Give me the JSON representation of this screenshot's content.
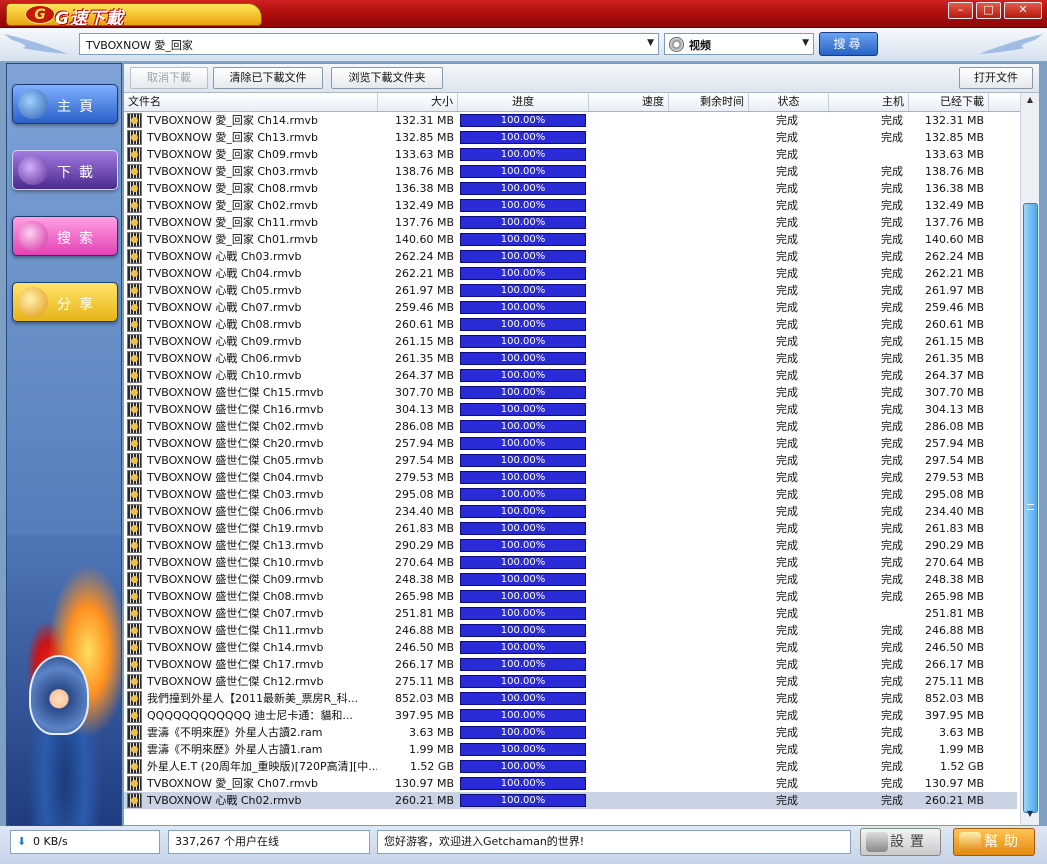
{
  "app": {
    "logo_text": "G速下載",
    "logo_badge": "G"
  },
  "window_controls": {
    "minimize": "–",
    "maximize": "□",
    "close": "✕"
  },
  "header": {
    "search_value": "TVBOXNOW 愛_回家",
    "type_value": "视频",
    "search_button": "搜尋"
  },
  "sidebar": {
    "items": [
      {
        "label": "主頁"
      },
      {
        "label": "下載"
      },
      {
        "label": "搜索"
      },
      {
        "label": "分享"
      }
    ]
  },
  "toolbar": {
    "cancel": "取消下載",
    "clear": "清除已下載文件",
    "browse": "浏览下載文件夹",
    "open": "打开文件"
  },
  "columns": {
    "name": "文件名",
    "size": "大小",
    "progress": "进度",
    "speed": "速度",
    "remaining": "剩余时间",
    "status": "状态",
    "host": "主机",
    "downloaded": "已经下載"
  },
  "rows": [
    {
      "name": "TVBOXNOW 愛_回家 Ch14.rmvb",
      "size": "132.31 MB",
      "progress": "100.00%",
      "status": "完成",
      "host": "完成",
      "downloaded": "132.31 MB"
    },
    {
      "name": "TVBOXNOW 愛_回家 Ch13.rmvb",
      "size": "132.85 MB",
      "progress": "100.00%",
      "status": "完成",
      "host": "完成",
      "downloaded": "132.85 MB"
    },
    {
      "name": "TVBOXNOW 愛_回家 Ch09.rmvb",
      "size": "133.63 MB",
      "progress": "100.00%",
      "status": "完成",
      "host": "",
      "downloaded": "133.63 MB"
    },
    {
      "name": "TVBOXNOW 愛_回家 Ch03.rmvb",
      "size": "138.76 MB",
      "progress": "100.00%",
      "status": "完成",
      "host": "完成",
      "downloaded": "138.76 MB"
    },
    {
      "name": "TVBOXNOW 愛_回家 Ch08.rmvb",
      "size": "136.38 MB",
      "progress": "100.00%",
      "status": "完成",
      "host": "完成",
      "downloaded": "136.38 MB"
    },
    {
      "name": "TVBOXNOW 愛_回家 Ch02.rmvb",
      "size": "132.49 MB",
      "progress": "100.00%",
      "status": "完成",
      "host": "完成",
      "downloaded": "132.49 MB"
    },
    {
      "name": "TVBOXNOW 愛_回家 Ch11.rmvb",
      "size": "137.76 MB",
      "progress": "100.00%",
      "status": "完成",
      "host": "完成",
      "downloaded": "137.76 MB"
    },
    {
      "name": "TVBOXNOW 愛_回家 Ch01.rmvb",
      "size": "140.60 MB",
      "progress": "100.00%",
      "status": "完成",
      "host": "完成",
      "downloaded": "140.60 MB"
    },
    {
      "name": "TVBOXNOW 心戰 Ch03.rmvb",
      "size": "262.24 MB",
      "progress": "100.00%",
      "status": "完成",
      "host": "完成",
      "downloaded": "262.24 MB"
    },
    {
      "name": "TVBOXNOW 心戰 Ch04.rmvb",
      "size": "262.21 MB",
      "progress": "100.00%",
      "status": "完成",
      "host": "完成",
      "downloaded": "262.21 MB"
    },
    {
      "name": "TVBOXNOW 心戰 Ch05.rmvb",
      "size": "261.97 MB",
      "progress": "100.00%",
      "status": "完成",
      "host": "完成",
      "downloaded": "261.97 MB"
    },
    {
      "name": "TVBOXNOW 心戰 Ch07.rmvb",
      "size": "259.46 MB",
      "progress": "100.00%",
      "status": "完成",
      "host": "完成",
      "downloaded": "259.46 MB"
    },
    {
      "name": "TVBOXNOW 心戰 Ch08.rmvb",
      "size": "260.61 MB",
      "progress": "100.00%",
      "status": "完成",
      "host": "完成",
      "downloaded": "260.61 MB"
    },
    {
      "name": "TVBOXNOW 心戰 Ch09.rmvb",
      "size": "261.15 MB",
      "progress": "100.00%",
      "status": "完成",
      "host": "完成",
      "downloaded": "261.15 MB"
    },
    {
      "name": "TVBOXNOW 心戰 Ch06.rmvb",
      "size": "261.35 MB",
      "progress": "100.00%",
      "status": "完成",
      "host": "完成",
      "downloaded": "261.35 MB"
    },
    {
      "name": "TVBOXNOW 心戰 Ch10.rmvb",
      "size": "264.37 MB",
      "progress": "100.00%",
      "status": "完成",
      "host": "完成",
      "downloaded": "264.37 MB"
    },
    {
      "name": "TVBOXNOW 盛世仁傑 Ch15.rmvb",
      "size": "307.70 MB",
      "progress": "100.00%",
      "status": "完成",
      "host": "完成",
      "downloaded": "307.70 MB"
    },
    {
      "name": "TVBOXNOW 盛世仁傑 Ch16.rmvb",
      "size": "304.13 MB",
      "progress": "100.00%",
      "status": "完成",
      "host": "完成",
      "downloaded": "304.13 MB"
    },
    {
      "name": "TVBOXNOW 盛世仁傑 Ch02.rmvb",
      "size": "286.08 MB",
      "progress": "100.00%",
      "status": "完成",
      "host": "完成",
      "downloaded": "286.08 MB"
    },
    {
      "name": "TVBOXNOW 盛世仁傑 Ch20.rmvb",
      "size": "257.94 MB",
      "progress": "100.00%",
      "status": "完成",
      "host": "完成",
      "downloaded": "257.94 MB"
    },
    {
      "name": "TVBOXNOW 盛世仁傑 Ch05.rmvb",
      "size": "297.54 MB",
      "progress": "100.00%",
      "status": "完成",
      "host": "完成",
      "downloaded": "297.54 MB"
    },
    {
      "name": "TVBOXNOW 盛世仁傑 Ch04.rmvb",
      "size": "279.53 MB",
      "progress": "100.00%",
      "status": "完成",
      "host": "完成",
      "downloaded": "279.53 MB"
    },
    {
      "name": "TVBOXNOW 盛世仁傑 Ch03.rmvb",
      "size": "295.08 MB",
      "progress": "100.00%",
      "status": "完成",
      "host": "完成",
      "downloaded": "295.08 MB"
    },
    {
      "name": "TVBOXNOW 盛世仁傑 Ch06.rmvb",
      "size": "234.40 MB",
      "progress": "100.00%",
      "status": "完成",
      "host": "完成",
      "downloaded": "234.40 MB"
    },
    {
      "name": "TVBOXNOW 盛世仁傑 Ch19.rmvb",
      "size": "261.83 MB",
      "progress": "100.00%",
      "status": "完成",
      "host": "完成",
      "downloaded": "261.83 MB"
    },
    {
      "name": "TVBOXNOW 盛世仁傑 Ch13.rmvb",
      "size": "290.29 MB",
      "progress": "100.00%",
      "status": "完成",
      "host": "完成",
      "downloaded": "290.29 MB"
    },
    {
      "name": "TVBOXNOW 盛世仁傑 Ch10.rmvb",
      "size": "270.64 MB",
      "progress": "100.00%",
      "status": "完成",
      "host": "完成",
      "downloaded": "270.64 MB"
    },
    {
      "name": "TVBOXNOW 盛世仁傑 Ch09.rmvb",
      "size": "248.38 MB",
      "progress": "100.00%",
      "status": "完成",
      "host": "完成",
      "downloaded": "248.38 MB"
    },
    {
      "name": "TVBOXNOW 盛世仁傑 Ch08.rmvb",
      "size": "265.98 MB",
      "progress": "100.00%",
      "status": "完成",
      "host": "完成",
      "downloaded": "265.98 MB"
    },
    {
      "name": "TVBOXNOW 盛世仁傑 Ch07.rmvb",
      "size": "251.81 MB",
      "progress": "100.00%",
      "status": "完成",
      "host": "",
      "downloaded": "251.81 MB"
    },
    {
      "name": "TVBOXNOW 盛世仁傑 Ch11.rmvb",
      "size": "246.88 MB",
      "progress": "100.00%",
      "status": "完成",
      "host": "完成",
      "downloaded": "246.88 MB"
    },
    {
      "name": "TVBOXNOW 盛世仁傑 Ch14.rmvb",
      "size": "246.50 MB",
      "progress": "100.00%",
      "status": "完成",
      "host": "完成",
      "downloaded": "246.50 MB"
    },
    {
      "name": "TVBOXNOW 盛世仁傑 Ch17.rmvb",
      "size": "266.17 MB",
      "progress": "100.00%",
      "status": "完成",
      "host": "完成",
      "downloaded": "266.17 MB"
    },
    {
      "name": "TVBOXNOW 盛世仁傑 Ch12.rmvb",
      "size": "275.11 MB",
      "progress": "100.00%",
      "status": "完成",
      "host": "完成",
      "downloaded": "275.11 MB"
    },
    {
      "name": "我們撞到外星人【2011最新美_票房R_科...",
      "size": "852.03 MB",
      "progress": "100.00%",
      "status": "完成",
      "host": "完成",
      "downloaded": "852.03 MB"
    },
    {
      "name": "QQQQQQQQQQQQ 迪士尼卡通：貓和...",
      "size": "397.95 MB",
      "progress": "100.00%",
      "status": "完成",
      "host": "完成",
      "downloaded": "397.95 MB"
    },
    {
      "name": "雲濤《不明來歷》外星人古讀2.ram",
      "size": "3.63 MB",
      "progress": "100.00%",
      "status": "完成",
      "host": "完成",
      "downloaded": "3.63 MB"
    },
    {
      "name": "雲濤《不明來歷》外星人古讀1.ram",
      "size": "1.99 MB",
      "progress": "100.00%",
      "status": "完成",
      "host": "完成",
      "downloaded": "1.99 MB"
    },
    {
      "name": "外星人E.T (20周年加_重映版)[720P高清][中...",
      "size": "1.52 GB",
      "progress": "100.00%",
      "status": "完成",
      "host": "完成",
      "downloaded": "1.52 GB"
    },
    {
      "name": "TVBOXNOW 愛_回家 Ch07.rmvb",
      "size": "130.97 MB",
      "progress": "100.00%",
      "status": "完成",
      "host": "完成",
      "downloaded": "130.97 MB"
    },
    {
      "name": "TVBOXNOW 心戰 Ch02.rmvb",
      "size": "260.21 MB",
      "progress": "100.00%",
      "status": "完成",
      "host": "完成",
      "downloaded": "260.21 MB",
      "selected": true
    }
  ],
  "statusbar": {
    "speed": "0 KB/s",
    "online": "337,267 个用户在线",
    "message": "您好游客，欢迎进入Getchaman的世界!",
    "settings": "設置",
    "help": "幫助"
  },
  "colors": {
    "progress_fill": "#2a2ad6",
    "titlebar": "#a80b0b",
    "selected_row": "#c9d3e3"
  }
}
